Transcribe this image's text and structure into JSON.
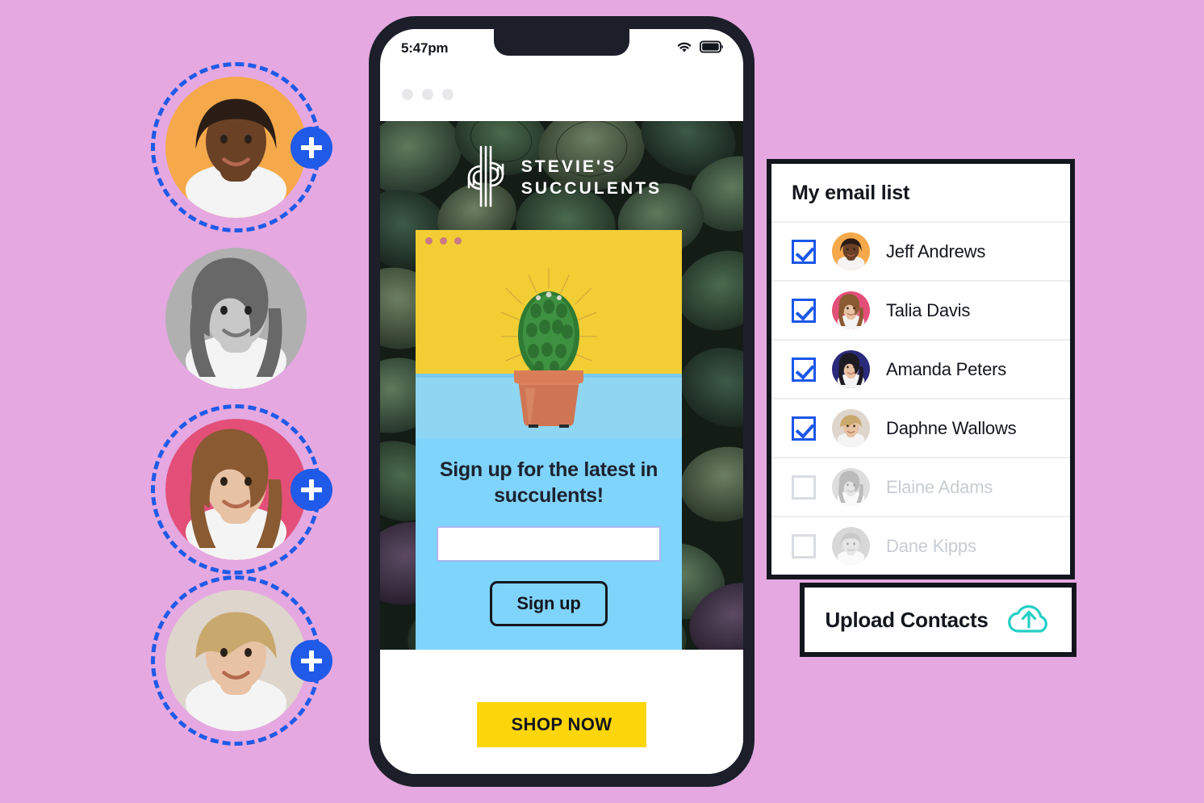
{
  "background_color": "#e5a8e0",
  "accent_colors": {
    "badge_blue": "#1f5ae8",
    "checkbox_blue": "#1a56e8",
    "panel_cyan": "#7fd4fb",
    "card_yellow": "#f2ce34",
    "shop_yellow": "#fcd60a",
    "cloud_teal": "#24cfc4",
    "phone_frame": "#1c1f2a"
  },
  "avatar_column": {
    "items": [
      {
        "name": "avatar-jeff",
        "bg": "#f5a94b",
        "ring": true,
        "badge": true,
        "grayscale": false,
        "badge_icon": "plus-icon"
      },
      {
        "name": "avatar-elaine",
        "bg": "#b0b0b0",
        "ring": false,
        "badge": false,
        "grayscale": true,
        "badge_icon": ""
      },
      {
        "name": "avatar-talia",
        "bg": "#e34f78",
        "ring": true,
        "badge": true,
        "grayscale": false,
        "badge_icon": "plus-icon"
      },
      {
        "name": "avatar-daphne",
        "bg": "#ded5cc",
        "ring": true,
        "badge": true,
        "grayscale": false,
        "badge_icon": "plus-icon"
      }
    ]
  },
  "phone": {
    "status_bar": {
      "time": "5:47pm",
      "wifi_icon": "wifi-icon",
      "battery_icon": "battery-icon"
    },
    "browser_chrome": {
      "dots": 3
    },
    "brand": {
      "logo_icon": "cactus-monogram-icon",
      "line1": "STEVIE'S",
      "line2": "SUCCULENTS"
    },
    "promo_card": {
      "dots": 3,
      "product_image_alt": "barrel-cactus-in-terracotta-pot",
      "headline": "Sign up for the latest in succulents!",
      "email_input_value": "",
      "email_input_placeholder": "",
      "signup_label": "Sign up"
    },
    "footer": {
      "shop_now_label": "SHOP NOW"
    }
  },
  "email_panel": {
    "title": "My email list",
    "contacts": [
      {
        "name": "Jeff Andrews",
        "checked": true,
        "avatar_bg": "#f5a94b",
        "muted": false,
        "avatar_kind": "man-short-hair"
      },
      {
        "name": "Talia Davis",
        "checked": true,
        "avatar_bg": "#e34f78",
        "muted": false,
        "avatar_kind": "woman-long-hair"
      },
      {
        "name": "Amanda Peters",
        "checked": true,
        "avatar_bg": "#2a2a7a",
        "muted": false,
        "avatar_kind": "woman-dark-hair"
      },
      {
        "name": "Daphne Wallows",
        "checked": true,
        "avatar_bg": "#ded5cc",
        "muted": false,
        "avatar_kind": "woman-pixie-cut"
      },
      {
        "name": "Elaine Adams",
        "checked": false,
        "avatar_bg": "#b3b3b3",
        "muted": true,
        "avatar_kind": "woman-wavy-hair"
      },
      {
        "name": "Dane Kipps",
        "checked": false,
        "avatar_bg": "#a8a8a8",
        "muted": true,
        "avatar_kind": "man-light-hair"
      }
    ]
  },
  "upload_contacts": {
    "label": "Upload Contacts",
    "icon": "cloud-upload-icon"
  }
}
